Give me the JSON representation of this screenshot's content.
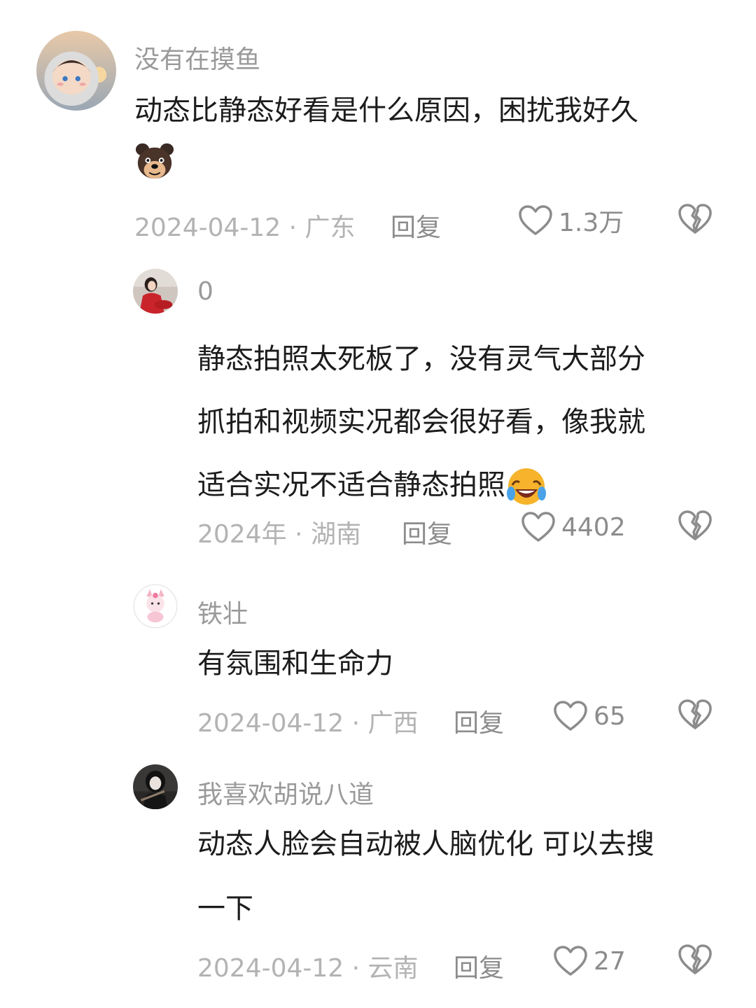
{
  "comments": [
    {
      "username": "没有在摸鱼",
      "content": "动态比静态好看是什么原因，困扰我好久",
      "emoji": "dog-face-emoji",
      "meta": "2024-04-12 · 广东",
      "reply_label": "回复",
      "likes": "1.3万"
    },
    {
      "username": "0",
      "content_lines": [
        "静态拍照太死板了，没有灵气大部分",
        "抓拍和视频实况都会很好看，像我就",
        "适合实况不适合静态拍照"
      ],
      "emoji": "crying-laughing-emoji",
      "meta": "2024年 · 湖南",
      "reply_label": "回复",
      "likes": "4402"
    },
    {
      "username": "铁壮",
      "content": "有氛围和生命力",
      "meta": "2024-04-12 · 广西",
      "reply_label": "回复",
      "likes": "65"
    },
    {
      "username": "我喜欢胡说八道",
      "content_lines": [
        "动态人脸会自动被人脑优化 可以去搜",
        "一下"
      ],
      "meta": "2024-04-12 · 云南",
      "reply_label": "回复",
      "likes": "27"
    }
  ],
  "colors": {
    "text": "#1c1c1c",
    "username": "#9a9a9a",
    "meta": "#b3b3b3",
    "action": "#8c8c8c"
  }
}
